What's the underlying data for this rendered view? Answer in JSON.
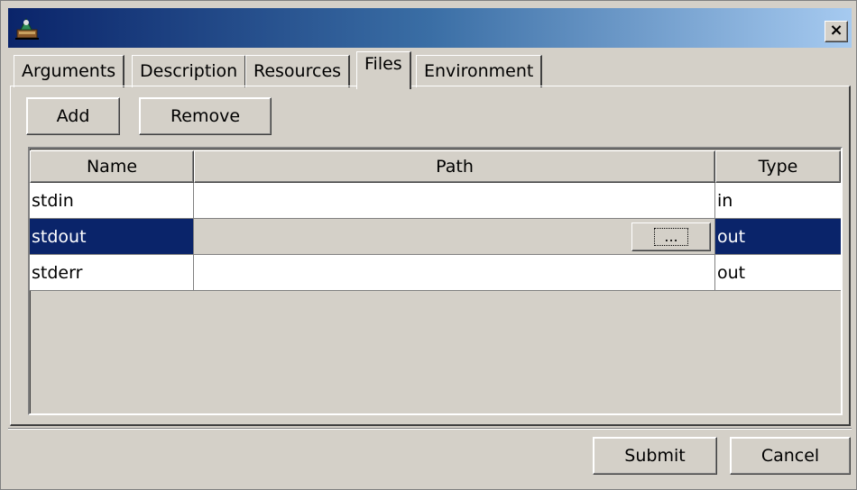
{
  "window": {
    "title": ""
  },
  "tabs": [
    {
      "label": "Arguments"
    },
    {
      "label": "Description"
    },
    {
      "label": "Resources"
    },
    {
      "label": "Files"
    },
    {
      "label": "Environment"
    }
  ],
  "active_tab": "Files",
  "toolbar": {
    "add_label": "Add",
    "remove_label": "Remove"
  },
  "table": {
    "columns": [
      "Name",
      "Path",
      "Type"
    ],
    "rows": [
      {
        "name": "stdin",
        "path": "",
        "type": "in"
      },
      {
        "name": "stdout",
        "path": "",
        "type": "out",
        "browse_label": "..."
      },
      {
        "name": "stderr",
        "path": "",
        "type": "out"
      }
    ],
    "selected_row": 1
  },
  "footer": {
    "submit_label": "Submit",
    "cancel_label": "Cancel"
  },
  "icons": {
    "app": "app-icon",
    "close": "close-icon",
    "close_glyph": "×"
  },
  "colors": {
    "title_start": "#0a246a",
    "title_end": "#a6caf0",
    "selection": "#0a246a",
    "face": "#d4d0c8"
  }
}
